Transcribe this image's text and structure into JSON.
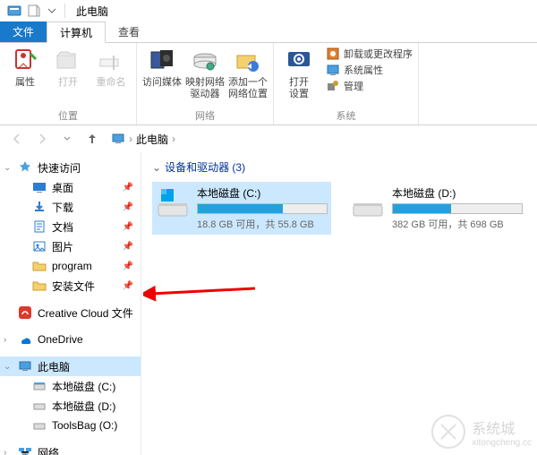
{
  "window": {
    "title": "此电脑"
  },
  "tabs": {
    "file": "文件",
    "computer": "计算机",
    "view": "查看"
  },
  "ribbon": {
    "group_location": {
      "name": "位置",
      "items": {
        "properties": "属性",
        "open": "打开",
        "rename": "重命名"
      }
    },
    "group_network": {
      "name": "网络",
      "items": {
        "media": "访问媒体",
        "map": "映射网络\n驱动器",
        "addloc": "添加一个\n网络位置"
      }
    },
    "group_system": {
      "name": "系统",
      "open_settings": "打开\n设置",
      "list": {
        "uninstall": "卸载或更改程序",
        "sysprop": "系统属性",
        "manage": "管理"
      }
    }
  },
  "nav": {
    "back_disabled": true,
    "fwd_disabled": true
  },
  "breadcrumb": {
    "root": "此电脑"
  },
  "sidebar": {
    "quick_access": "快速访问",
    "items": [
      {
        "label": "桌面",
        "pinned": true,
        "icon": "desktop"
      },
      {
        "label": "下载",
        "pinned": true,
        "icon": "downloads"
      },
      {
        "label": "文档",
        "pinned": true,
        "icon": "documents"
      },
      {
        "label": "图片",
        "pinned": true,
        "icon": "pictures"
      },
      {
        "label": "program",
        "pinned": true,
        "icon": "folder"
      },
      {
        "label": "安装文件",
        "pinned": true,
        "icon": "folder"
      }
    ],
    "creative_cloud": "Creative Cloud 文件",
    "onedrive": "OneDrive",
    "this_pc": "此电脑",
    "drives": [
      {
        "label": "本地磁盘 (C:)"
      },
      {
        "label": "本地磁盘 (D:)"
      },
      {
        "label": "ToolsBag (O:)"
      }
    ],
    "network": "网络"
  },
  "main": {
    "section_title": "设备和驱动器 (3)",
    "drives": [
      {
        "name": "本地磁盘 (C:)",
        "space": "18.8 GB 可用，共 55.8 GB",
        "fill_pct": 66,
        "selected": true,
        "os": true
      },
      {
        "name": "本地磁盘 (D:)",
        "space": "382 GB 可用，共 698 GB",
        "fill_pct": 45,
        "selected": false,
        "os": false
      }
    ]
  },
  "watermark": {
    "text": "系统城",
    "sub": "xitongcheng.cc"
  }
}
